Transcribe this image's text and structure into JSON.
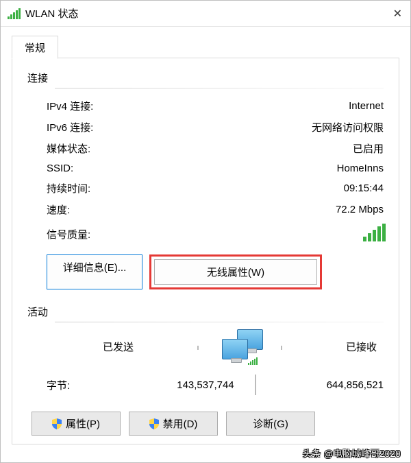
{
  "window": {
    "title": "WLAN 状态",
    "close_glyph": "✕"
  },
  "tabs": {
    "general": "常规"
  },
  "connection": {
    "section_title": "连接",
    "ipv4_label": "IPv4 连接:",
    "ipv4_value": "Internet",
    "ipv6_label": "IPv6 连接:",
    "ipv6_value": "无网络访问权限",
    "media_label": "媒体状态:",
    "media_value": "已启用",
    "ssid_label": "SSID:",
    "ssid_value": "HomeInns",
    "duration_label": "持续时间:",
    "duration_value": "09:15:44",
    "speed_label": "速度:",
    "speed_value": "72.2 Mbps",
    "signal_label": "信号质量:"
  },
  "buttons": {
    "details": "详细信息(E)...",
    "wireless_props": "无线属性(W)",
    "properties": "属性(P)",
    "disable": "禁用(D)",
    "diagnose": "诊断(G)"
  },
  "activity": {
    "section_title": "活动",
    "sent_label": "已发送",
    "received_label": "已接收",
    "bytes_label": "字节:",
    "bytes_sent": "143,537,744",
    "bytes_received": "644,856,521"
  },
  "watermark": "头条 @电脑城峰哥2020"
}
